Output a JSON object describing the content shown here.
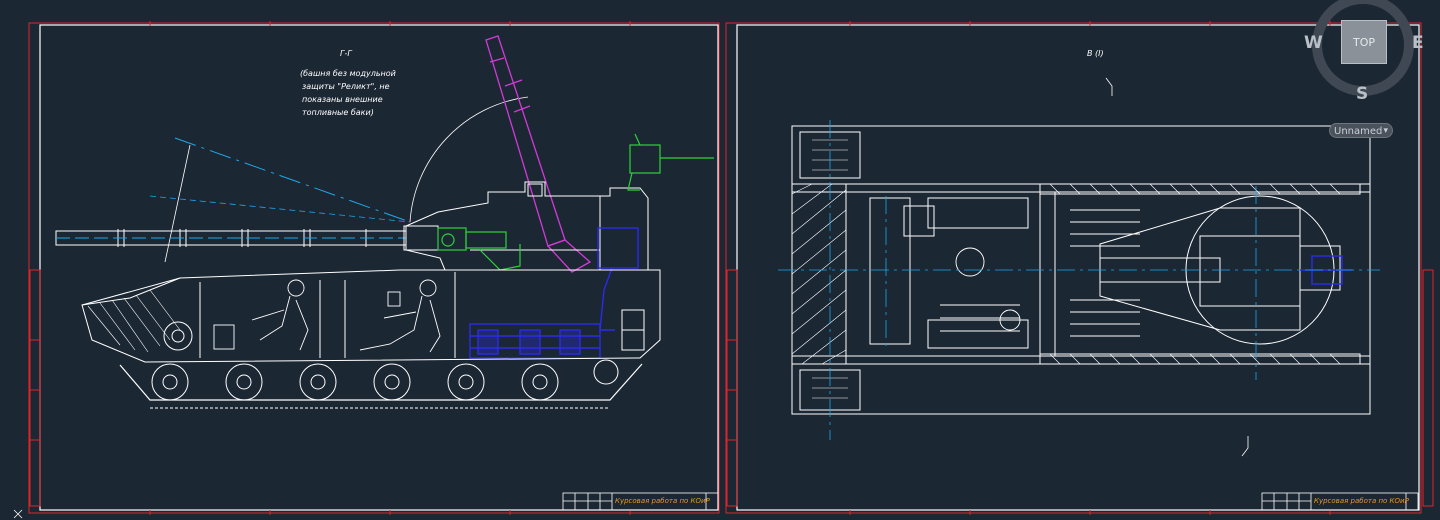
{
  "viewcube": {
    "face": "TOP",
    "west": "W",
    "east": "E",
    "south": "S"
  },
  "ucs_menu": {
    "label": "Unnamed"
  },
  "left_sheet": {
    "section_label": "Г-Г",
    "note_lines": [
      "(башня  без модульной",
      "защиты \"Реликт\", не",
      "показаны внешние",
      "топливные баки)"
    ],
    "stamp_text": "Курсовая работа по КОиР"
  },
  "right_sheet": {
    "view_label": "В (I)",
    "stamp_text": "Курсовая работа по КОиР"
  },
  "colors": {
    "background": "#1c2734",
    "line": "#ffffff",
    "frame_red": "#e0242a",
    "axis_cyan": "#1ea7e8",
    "gun_magenta": "#d23ad6",
    "mount_green": "#2fd13a",
    "equip_blue": "#2b2be8",
    "stamp_orange": "#e39a2a"
  }
}
